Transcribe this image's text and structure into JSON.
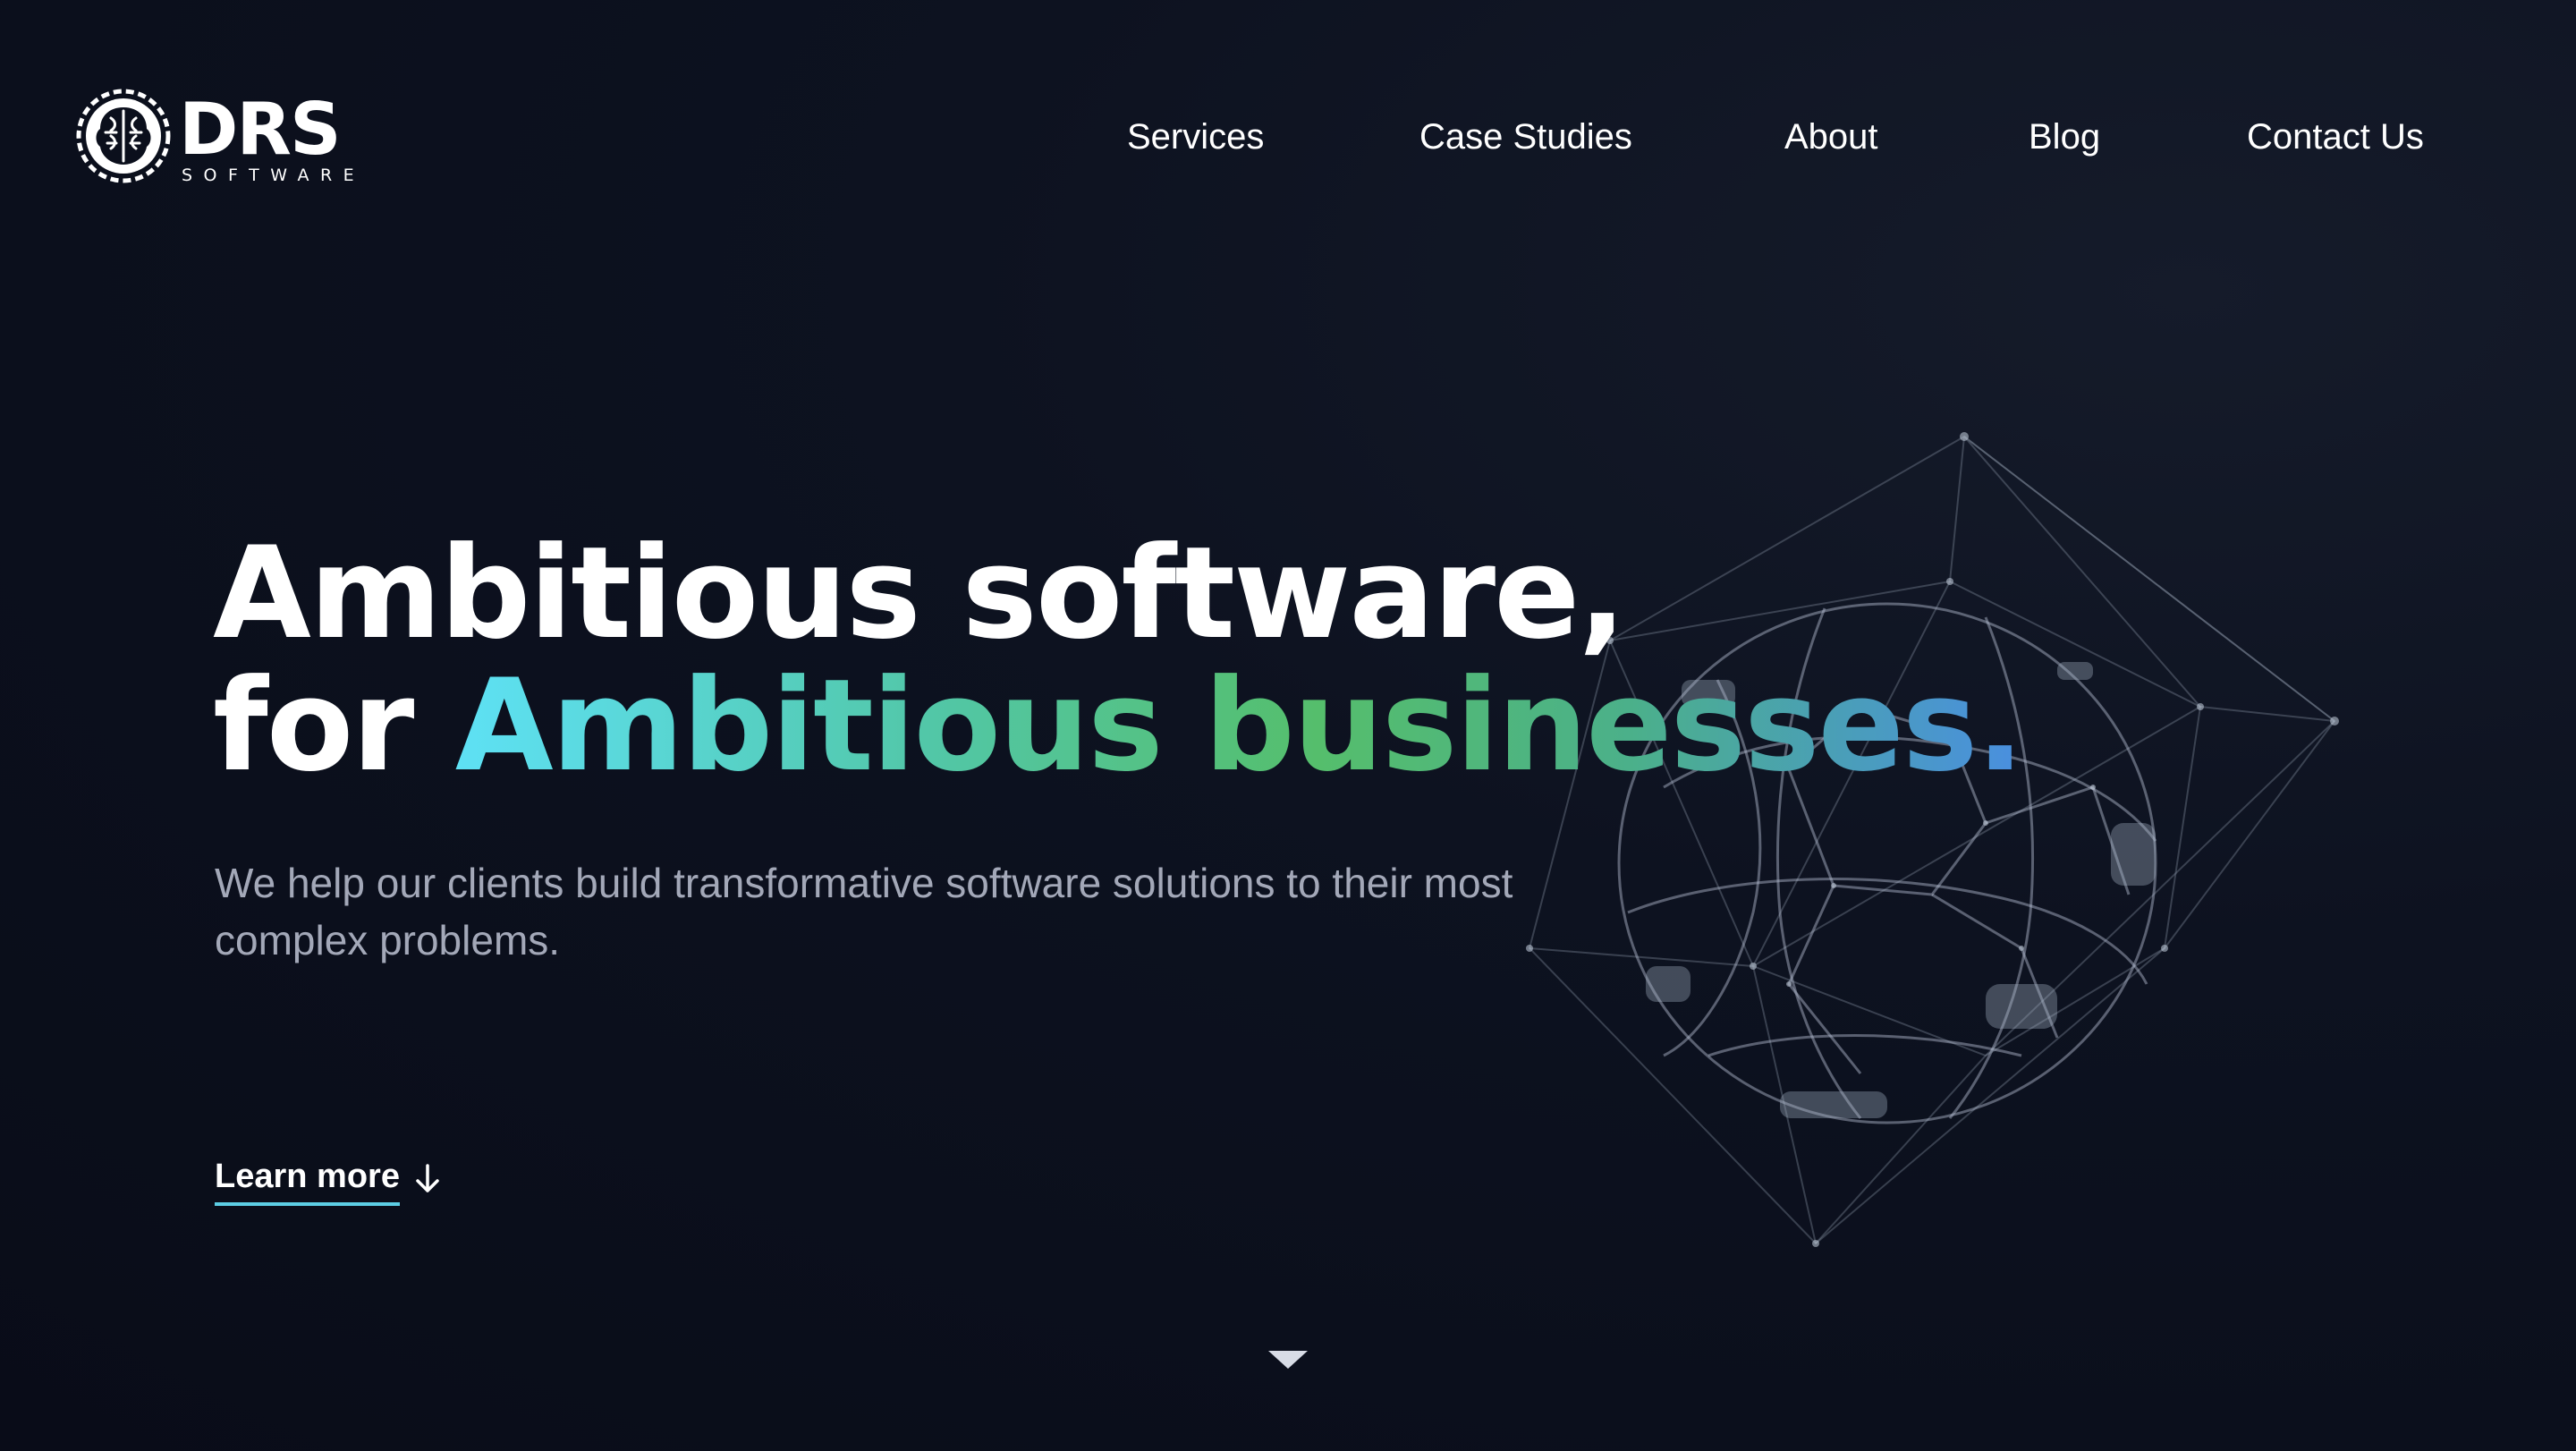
{
  "brand": {
    "name": "DRS",
    "tagline": "SOFTWARE",
    "logo_icon": "brain-gear-icon"
  },
  "nav": {
    "items": [
      {
        "label": "Services"
      },
      {
        "label": "Case Studies"
      },
      {
        "label": "About"
      },
      {
        "label": "Blog"
      },
      {
        "label": "Contact Us"
      }
    ]
  },
  "hero": {
    "title_line1": "Ambitious software,",
    "title_line2_prefix": "for ",
    "title_line2_highlight": "Ambitious businesses.",
    "subtitle": "We help our clients build transformative software solutions to their most complex problems.",
    "cta_label": "Learn more",
    "cta_icon": "arrow-down-icon",
    "scroll_icon": "caret-down-icon",
    "illustration": "wireframe-globe-icon"
  },
  "colors": {
    "background": "#0a0e1a",
    "text": "#ffffff",
    "subtitle": "#a3a8b8",
    "gradient_start": "#5ee1f5",
    "gradient_mid": "#55be6c",
    "gradient_end": "#4a8fe0",
    "cta_underline": "#5ccde4"
  }
}
